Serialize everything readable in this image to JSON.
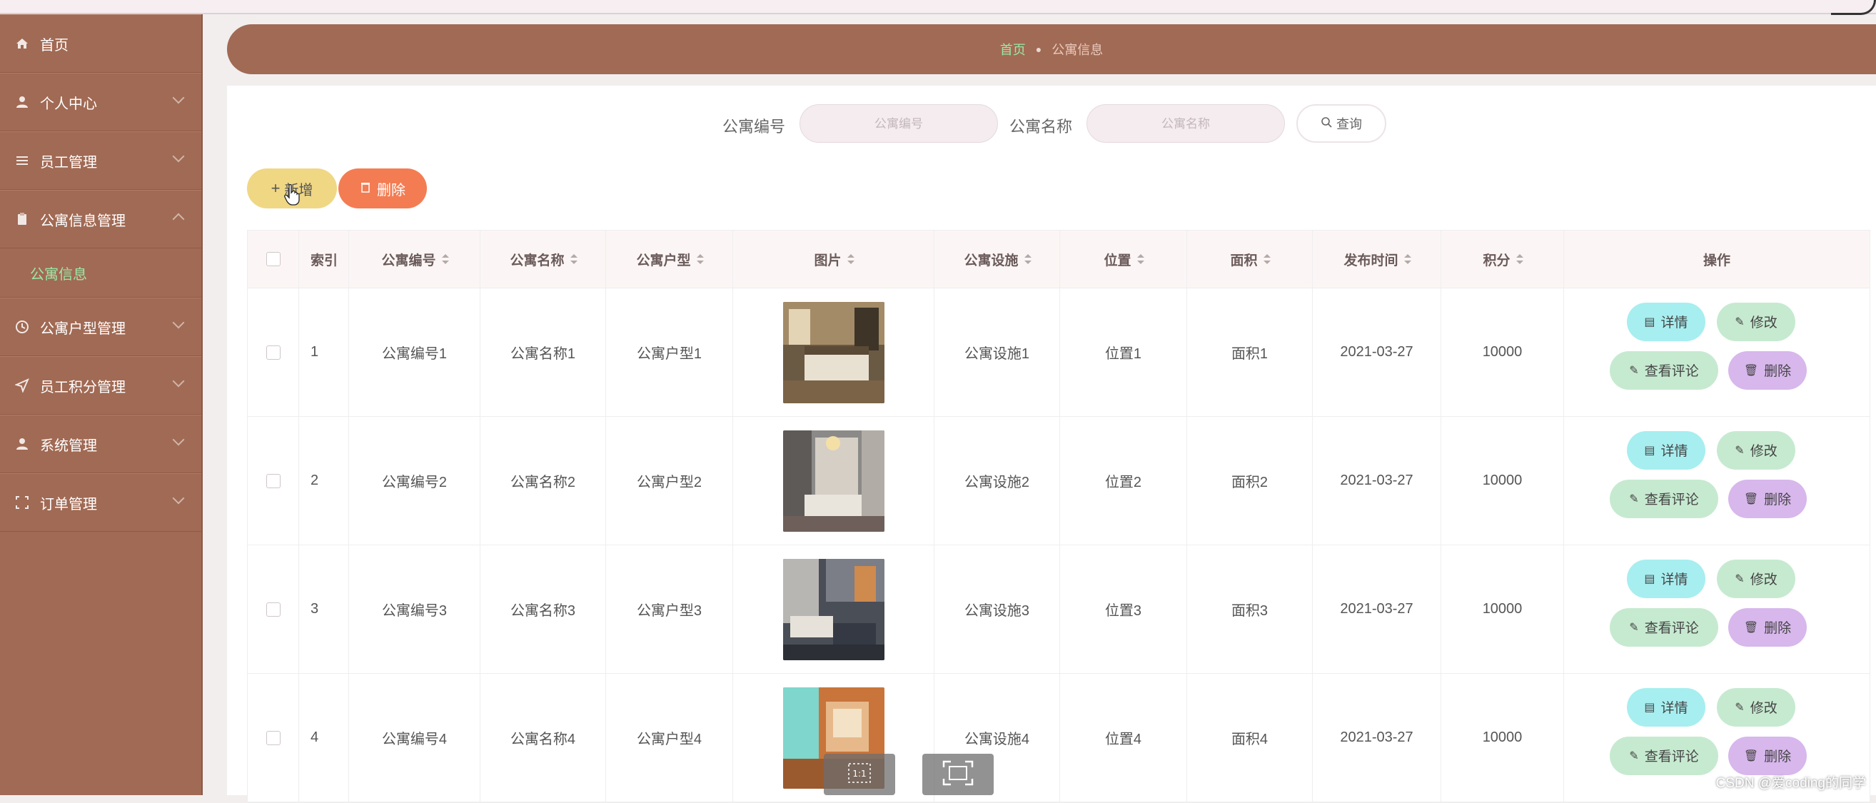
{
  "sidebar": {
    "items": [
      {
        "label": "首页",
        "icon": "home-icon"
      },
      {
        "label": "个人中心",
        "icon": "user-icon"
      },
      {
        "label": "员工管理",
        "icon": "list-icon"
      },
      {
        "label": "公寓信息管理",
        "icon": "clipboard-icon",
        "expanded": true
      },
      {
        "label": "公寓户型管理",
        "icon": "clock-icon"
      },
      {
        "label": "员工积分管理",
        "icon": "send-icon"
      },
      {
        "label": "系统管理",
        "icon": "user-icon"
      },
      {
        "label": "订单管理",
        "icon": "scan-icon"
      }
    ],
    "submenu": {
      "label": "公寓信息"
    }
  },
  "breadcrumb": {
    "home": "首页",
    "current": "公寓信息"
  },
  "search": {
    "no_label": "公寓编号",
    "no_placeholder": "公寓编号",
    "name_label": "公寓名称",
    "name_placeholder": "公寓名称",
    "button": "查询"
  },
  "actions": {
    "add": "新增",
    "delete": "删除"
  },
  "table": {
    "headers": {
      "index": "索引",
      "no": "公寓编号",
      "name": "公寓名称",
      "type": "公寓户型",
      "image": "图片",
      "facility": "公寓设施",
      "position": "位置",
      "area": "面积",
      "time": "发布时间",
      "score": "积分",
      "ops": "操作"
    },
    "rows": [
      {
        "index": "1",
        "no": "公寓编号1",
        "name": "公寓名称1",
        "type": "公寓户型1",
        "facility": "公寓设施1",
        "position": "位置1",
        "area": "面积1",
        "time": "2021-03-27",
        "score": "10000"
      },
      {
        "index": "2",
        "no": "公寓编号2",
        "name": "公寓名称2",
        "type": "公寓户型2",
        "facility": "公寓设施2",
        "position": "位置2",
        "area": "面积2",
        "time": "2021-03-27",
        "score": "10000"
      },
      {
        "index": "3",
        "no": "公寓编号3",
        "name": "公寓名称3",
        "type": "公寓户型3",
        "facility": "公寓设施3",
        "position": "位置3",
        "area": "面积3",
        "time": "2021-03-27",
        "score": "10000"
      },
      {
        "index": "4",
        "no": "公寓编号4",
        "name": "公寓名称4",
        "type": "公寓户型4",
        "facility": "公寓设施4",
        "position": "位置4",
        "area": "面积4",
        "time": "2021-03-27",
        "score": "10000"
      }
    ],
    "row_actions": {
      "detail": "详情",
      "edit": "修改",
      "comment": "查看评论",
      "remove": "删除"
    }
  },
  "watermark": "CSDN @爱coding的同学",
  "colors": {
    "sidebar": "#a16a54",
    "accent": "#9be7a6",
    "add": "#f0d784",
    "delete": "#f47c52",
    "detail": "#a7eef0",
    "edit": "#c6ead0",
    "remove": "#d7b7ec"
  }
}
